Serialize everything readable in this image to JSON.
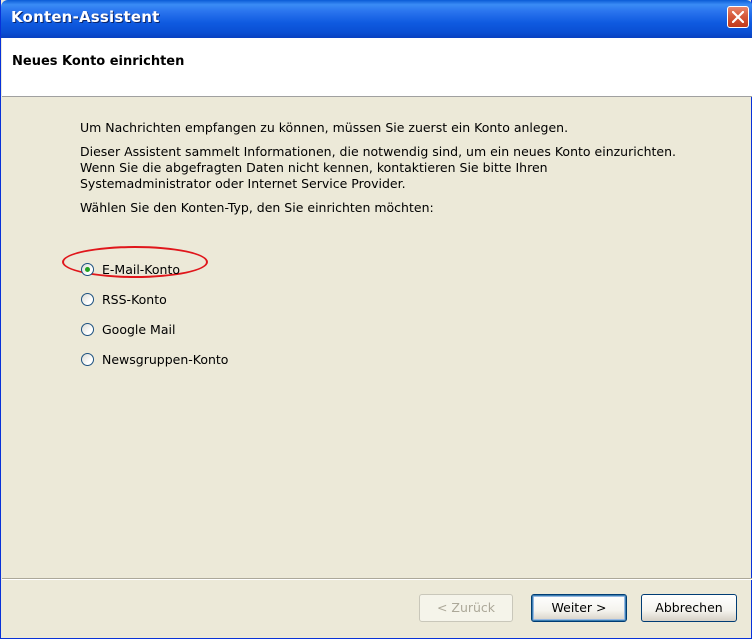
{
  "window": {
    "title": "Konten-Assistent"
  },
  "header": {
    "title": "Neues Konto einrichten"
  },
  "content": {
    "line1": "Um Nachrichten empfangen zu können, müssen Sie zuerst ein Konto anlegen.",
    "line2a": "Dieser Assistent sammelt Informationen, die notwendig sind, um ein neues Konto einzurichten.",
    "line2b": "Wenn Sie die abgefragten Daten nicht kennen, kontaktieren Sie bitte Ihren",
    "line2c": "Systemadministrator oder Internet Service Provider.",
    "line3": "Wählen Sie den Konten-Typ, den Sie einrichten möchten:"
  },
  "options": [
    {
      "label": "E-Mail-Konto",
      "checked": true
    },
    {
      "label": "RSS-Konto",
      "checked": false
    },
    {
      "label": "Google Mail",
      "checked": false
    },
    {
      "label": "Newsgruppen-Konto",
      "checked": false
    }
  ],
  "buttons": {
    "back": "< Zurück",
    "next": "Weiter >",
    "cancel": "Abbrechen"
  },
  "colors": {
    "title_bar": "#0a5bd6",
    "highlight": "#e0161b",
    "radio_dot": "#21a121"
  }
}
